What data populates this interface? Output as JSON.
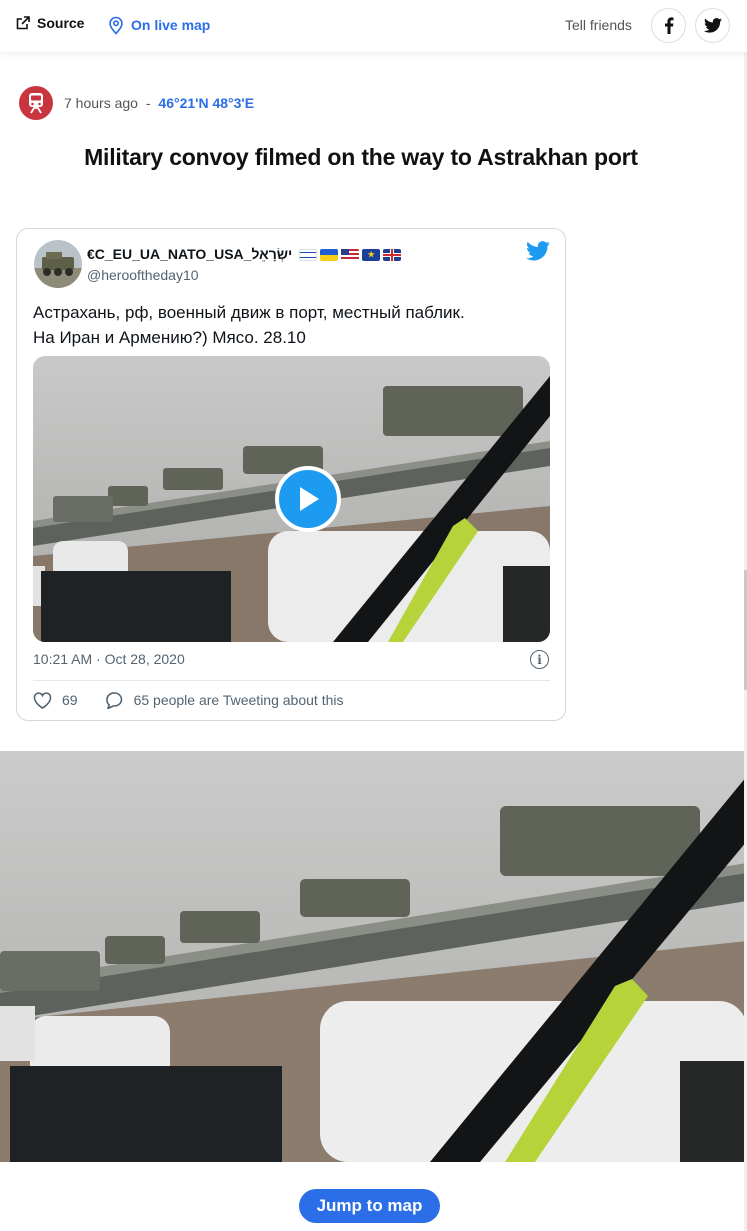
{
  "topbar": {
    "source_label": "Source",
    "source_icon": "external-link-icon",
    "livemap_label": "On live map",
    "livemap_icon": "map-pin-icon",
    "tell_friends_label": "Tell friends",
    "facebook_icon": "facebook-icon",
    "twitter_icon": "twitter-icon"
  },
  "event": {
    "category_icon": "train-icon",
    "category_color": "#c9353f",
    "time_ago": "7 hours ago",
    "separator": "-",
    "coordinates": "46°21'N 48°3'E",
    "headline": "Military convoy filmed on the way to Astrakhan port"
  },
  "tweet": {
    "author_name": "€C_EU_UA_NATO_USA_ישְׂרָאֵל",
    "author_handle": "@herooftheday10",
    "text_line1": "Астрахань, рф, военный движ в порт, местный паблик.",
    "text_line2": "На Иран и Армению?) Мясо. 28.10",
    "timestamp": "10:21 AM · Oct 28, 2020",
    "info_icon": "info-icon",
    "likes_count": "69",
    "replies_label": "65 people are Tweeting about this",
    "brand_color": "#1d9bf0"
  },
  "footer": {
    "jump_label": "Jump to map"
  },
  "colors": {
    "accent": "#2b6ee8",
    "twitter_blue": "#1d9bf0"
  }
}
